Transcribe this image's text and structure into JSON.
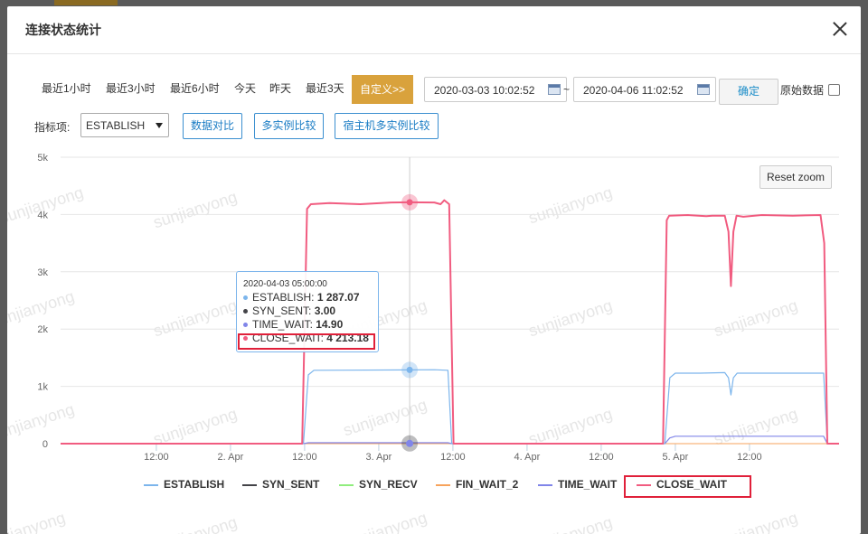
{
  "modal": {
    "title": "连接状态统计"
  },
  "watermark_text": "sunjianyong",
  "time_ranges": [
    {
      "label": "最近1小时",
      "active": false
    },
    {
      "label": "最近3小时",
      "active": false
    },
    {
      "label": "最近6小时",
      "active": false
    },
    {
      "label": "今天",
      "active": false
    },
    {
      "label": "昨天",
      "active": false
    },
    {
      "label": "最近3天",
      "active": false
    },
    {
      "label": "自定义>>",
      "active": true
    }
  ],
  "date_range": {
    "start": "2020-03-03 10:02:52",
    "separator": "~",
    "end": "2020-04-06 11:02:52"
  },
  "confirm_label": "确定",
  "raw_data": {
    "label": "原始数据",
    "checked": false
  },
  "metric": {
    "label": "指标项:",
    "selected": "ESTABLISH"
  },
  "tools": {
    "compare": "数据对比",
    "multi_instance": "多实例比较",
    "host_multi_instance": "宿主机多实例比较"
  },
  "reset_zoom_label": "Reset zoom",
  "colors": {
    "ESTABLISH": "#7cb5ec",
    "SYN_SENT": "#434348",
    "SYN_RECV": "#90ed7d",
    "FIN_WAIT_2": "#f7a35c",
    "TIME_WAIT": "#8085e9",
    "CLOSE_WAIT": "#f15c80",
    "highlight": "#e0203a",
    "active_range": "#d9a23c"
  },
  "tooltip": {
    "date": "2020-04-03 05:00:00",
    "rows": [
      {
        "name": "ESTABLISH",
        "value": "1 287.07"
      },
      {
        "name": "SYN_SENT",
        "value": "3.00"
      },
      {
        "name": "TIME_WAIT",
        "value": "14.90"
      },
      {
        "name": "CLOSE_WAIT",
        "value": "4 213.18"
      }
    ]
  },
  "chart_data": {
    "type": "line",
    "x_tick_labels": [
      "12:00",
      "2. Apr",
      "12:00",
      "3. Apr",
      "12:00",
      "4. Apr",
      "12:00",
      "5. Apr",
      "12:00"
    ],
    "x_ticks_hours": [
      12,
      24,
      36,
      48,
      60,
      72,
      84,
      96,
      108
    ],
    "x_range_hours": [
      -3.5,
      122.5
    ],
    "x_origin_note": "hours since 2020-04-01 00:00",
    "y_tick_labels": [
      "0",
      "1k",
      "2k",
      "3k",
      "4k",
      "5k"
    ],
    "ylim": [
      0,
      5000
    ],
    "grid": true,
    "legend": "bottom",
    "crosshair_hour": 53,
    "series": [
      {
        "name": "ESTABLISH",
        "points": [
          [
            -3.5,
            0
          ],
          [
            35.8,
            0
          ],
          [
            36.6,
            1200
          ],
          [
            37.5,
            1280
          ],
          [
            53,
            1287
          ],
          [
            57,
            1290
          ],
          [
            59.2,
            1280
          ],
          [
            59.8,
            0
          ],
          [
            94.3,
            0
          ],
          [
            95.1,
            1150
          ],
          [
            96,
            1230
          ],
          [
            100,
            1230
          ],
          [
            104,
            1240
          ],
          [
            104.6,
            1150
          ],
          [
            105,
            850
          ],
          [
            105.4,
            1150
          ],
          [
            106,
            1230
          ],
          [
            120,
            1230
          ],
          [
            120.6,
            0
          ],
          [
            122.5,
            0
          ]
        ]
      },
      {
        "name": "SYN_SENT",
        "points": [
          [
            -3.5,
            0
          ],
          [
            122.5,
            0
          ]
        ]
      },
      {
        "name": "SYN_RECV",
        "points": [
          [
            -3.5,
            0
          ],
          [
            122.5,
            0
          ]
        ]
      },
      {
        "name": "FIN_WAIT_2",
        "points": [
          [
            -3.5,
            0
          ],
          [
            122.5,
            0
          ]
        ]
      },
      {
        "name": "TIME_WAIT",
        "points": [
          [
            -3.5,
            0
          ],
          [
            35.8,
            0
          ],
          [
            36.6,
            15
          ],
          [
            59.2,
            15
          ],
          [
            59.8,
            0
          ],
          [
            94.3,
            0
          ],
          [
            95.1,
            100
          ],
          [
            96,
            130
          ],
          [
            120,
            130
          ],
          [
            120.6,
            0
          ],
          [
            122.5,
            0
          ]
        ]
      },
      {
        "name": "CLOSE_WAIT",
        "points": [
          [
            -3.5,
            0
          ],
          [
            35.6,
            0
          ],
          [
            36.4,
            4100
          ],
          [
            37,
            4180
          ],
          [
            40,
            4200
          ],
          [
            45,
            4180
          ],
          [
            50,
            4210
          ],
          [
            53,
            4213
          ],
          [
            57,
            4210
          ],
          [
            58,
            4180
          ],
          [
            58.6,
            4250
          ],
          [
            59.4,
            4180
          ],
          [
            60.1,
            0
          ],
          [
            94,
            0
          ],
          [
            94.6,
            3900
          ],
          [
            95,
            3980
          ],
          [
            98,
            3990
          ],
          [
            101,
            3970
          ],
          [
            102,
            3980
          ],
          [
            104,
            3980
          ],
          [
            104.6,
            3700
          ],
          [
            105,
            2750
          ],
          [
            105.4,
            3700
          ],
          [
            105.9,
            3980
          ],
          [
            107,
            3960
          ],
          [
            110,
            3990
          ],
          [
            115,
            3980
          ],
          [
            119.5,
            3990
          ],
          [
            120.1,
            3500
          ],
          [
            120.6,
            0
          ],
          [
            122.5,
            0
          ]
        ]
      }
    ]
  }
}
